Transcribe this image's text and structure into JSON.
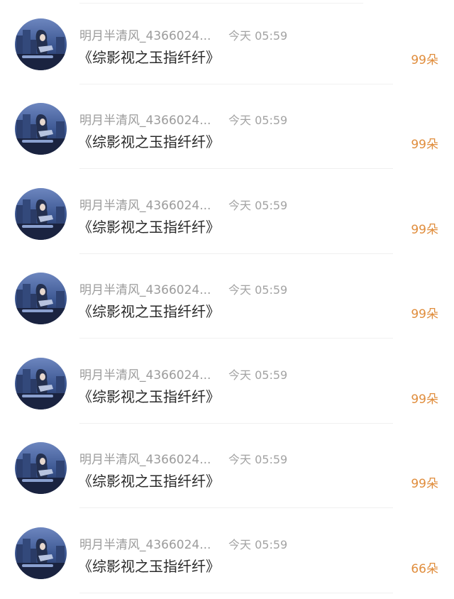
{
  "records": [
    {
      "user_name": "明月半清风_4366024...",
      "time": "今天 05:59",
      "book_title": "《综影视之玉指纤纤》",
      "gift_amount": "99朵"
    },
    {
      "user_name": "明月半清风_4366024...",
      "time": "今天 05:59",
      "book_title": "《综影视之玉指纤纤》",
      "gift_amount": "99朵"
    },
    {
      "user_name": "明月半清风_4366024...",
      "time": "今天 05:59",
      "book_title": "《综影视之玉指纤纤》",
      "gift_amount": "99朵"
    },
    {
      "user_name": "明月半清风_4366024...",
      "time": "今天 05:59",
      "book_title": "《综影视之玉指纤纤》",
      "gift_amount": "99朵"
    },
    {
      "user_name": "明月半清风_4366024...",
      "time": "今天 05:59",
      "book_title": "《综影视之玉指纤纤》",
      "gift_amount": "99朵"
    },
    {
      "user_name": "明月半清风_4366024...",
      "time": "今天 05:59",
      "book_title": "《综影视之玉指纤纤》",
      "gift_amount": "99朵"
    },
    {
      "user_name": "明月半清风_4366024...",
      "time": "今天 05:59",
      "book_title": "《综影视之玉指纤纤》",
      "gift_amount": "66朵"
    }
  ],
  "colors": {
    "name_gray": "#9b9b9b",
    "time_gray": "#a3a3a3",
    "title_dark": "#2b2b2b",
    "gift_orange": "#e08d3c",
    "avatar_sky": "#3a5590"
  },
  "icons": {
    "avatar": "night-city-girl-avatar-icon"
  }
}
